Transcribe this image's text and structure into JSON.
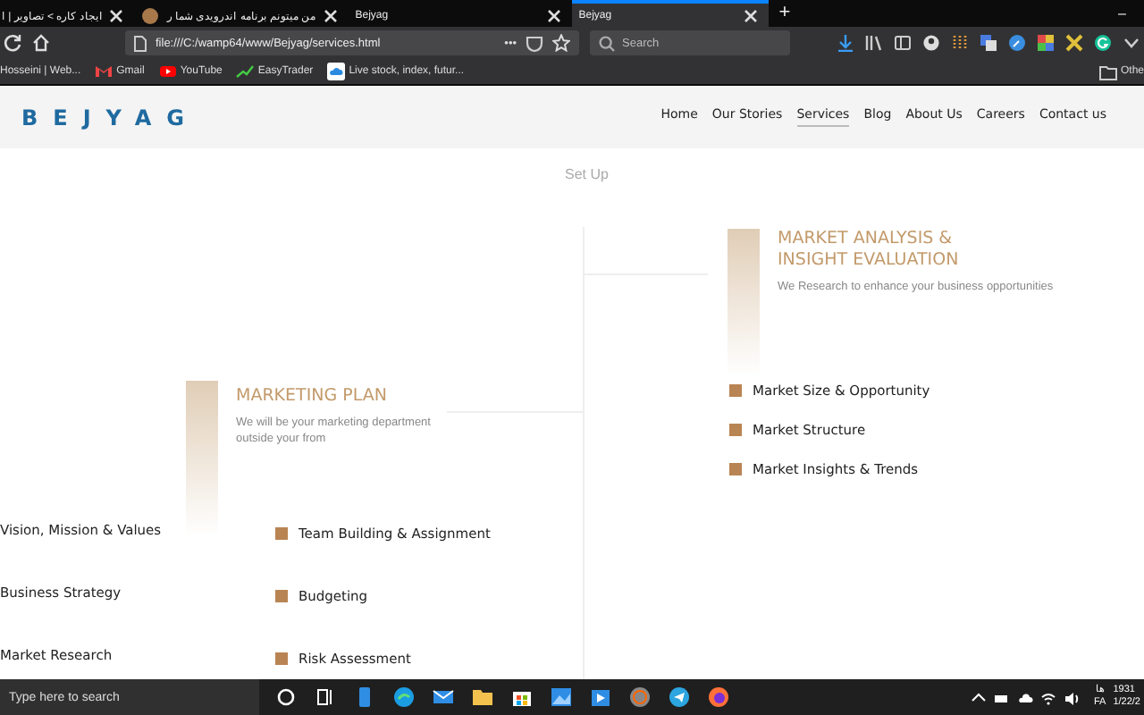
{
  "browser": {
    "tabs": [
      {
        "label": "ایجاد کاره > تصاویر | ا",
        "selected": false,
        "kind": "plain"
      },
      {
        "label": "من میتونم برنامه اندرویدی شما ر",
        "selected": false,
        "kind": "favicon"
      },
      {
        "label": "Bejyag",
        "selected": false,
        "kind": "plain"
      },
      {
        "label": "Bejyag",
        "selected": true,
        "kind": "plain"
      }
    ],
    "new_tab": "+",
    "minimize": "–",
    "url": "file:///C:/wamp64/www/Bejyag/services.html",
    "page_actions": "•••",
    "search": {
      "placeholder": "Search"
    },
    "bookmarks": [
      {
        "label": "Hosseini | Web...",
        "kind": "none"
      },
      {
        "label": "Gmail",
        "kind": "gmail"
      },
      {
        "label": "YouTube",
        "kind": "youtube"
      },
      {
        "label": "EasyTrader",
        "kind": "chart"
      },
      {
        "label": "Live stock, index, futur...",
        "kind": "cloud"
      }
    ],
    "other_bookmarks": "Othe"
  },
  "site": {
    "logo": "BEJYAG",
    "nav": [
      {
        "label": "Home",
        "selected": false
      },
      {
        "label": "Our Stories",
        "selected": false
      },
      {
        "label": "Services",
        "selected": true
      },
      {
        "label": "Blog",
        "selected": false
      },
      {
        "label": "About Us",
        "selected": false
      },
      {
        "label": "Careers",
        "selected": false
      },
      {
        "label": "Contact us",
        "selected": false
      }
    ],
    "section_title": "Set Up",
    "market_analysis": {
      "title": "MARKET ANALYSIS & INSIGHT EVALUATION",
      "subtitle": "We Research to enhance your business opportunities",
      "items": [
        "Market Size & Opportunity",
        "Market Structure",
        "Market Insights & Trends"
      ]
    },
    "marketing_plan": {
      "title": "MARKETING PLAN",
      "subtitle": "We will be your marketing department outside your from",
      "items": [
        "Team Building & Assignment",
        "Budgeting",
        "Risk Assessment"
      ]
    },
    "left_items": [
      "Vision, Mission & Values",
      "Business Strategy",
      "Market Research"
    ]
  },
  "taskbar": {
    "search": {
      "placeholder": "Type here to search"
    },
    "language": "FA",
    "language_top": "ها",
    "time": "1931",
    "date": "1/22/2"
  }
}
